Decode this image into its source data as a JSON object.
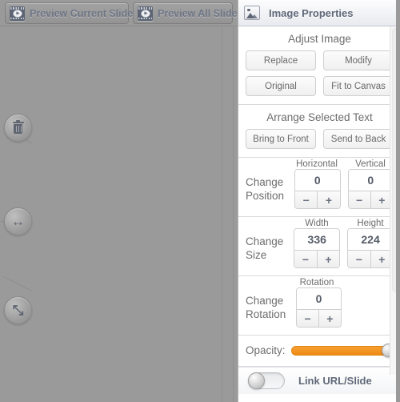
{
  "toolbar": {
    "preview_current_label": "Preview Current Slide",
    "preview_all_label": "Preview All Slides",
    "film_icon": "filmstrip-play-icon"
  },
  "canvas": {
    "handles": [
      {
        "name": "delete-handle",
        "icon": "trash-icon",
        "glyph": ""
      },
      {
        "name": "move-handle",
        "icon": "horizontal-arrows-icon",
        "glyph": "↔"
      },
      {
        "name": "resize-handle",
        "icon": "diagonal-resize-arrow-icon",
        "glyph": "⤡"
      }
    ]
  },
  "panel": {
    "title": "Image Properties",
    "icon": "image-icon",
    "adjust": {
      "title": "Adjust Image",
      "buttons": [
        "Replace",
        "Modify",
        "Original",
        "Fit to Canvas"
      ]
    },
    "arrange": {
      "title": "Arrange Selected Text",
      "buttons": [
        "Bring to Front",
        "Send to Back"
      ]
    },
    "position": {
      "label": "Change\nPosition",
      "label_line1": "Change",
      "label_line2": "Position",
      "fields": [
        {
          "head": "Horizontal",
          "value": "0",
          "minus": "−",
          "plus": "+"
        },
        {
          "head": "Vertical",
          "value": "0",
          "minus": "−",
          "plus": "+"
        }
      ]
    },
    "size": {
      "label_line1": "Change",
      "label_line2": "Size",
      "fields": [
        {
          "head": "Width",
          "value": "336",
          "minus": "−",
          "plus": "+"
        },
        {
          "head": "Height",
          "value": "224",
          "minus": "−",
          "plus": "+"
        }
      ]
    },
    "rotation": {
      "label_line1": "Change",
      "label_line2": "Rotation",
      "fields": [
        {
          "head": "Rotation",
          "value": "0",
          "minus": "−",
          "plus": "+"
        }
      ]
    },
    "opacity": {
      "label": "Opacity:",
      "value": 100,
      "accent_color": "#f08a15"
    },
    "link": {
      "label": "Link URL/Slide",
      "enabled": false
    }
  }
}
